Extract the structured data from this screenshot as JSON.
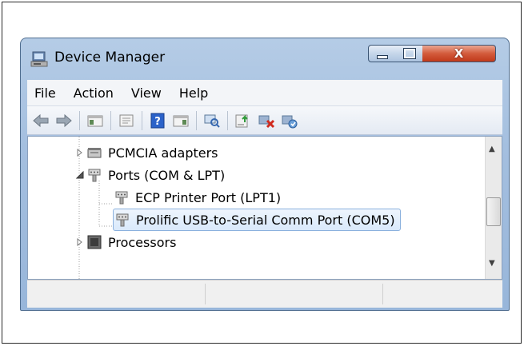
{
  "window": {
    "title": "Device Manager",
    "icon": "device-manager-icon",
    "controls": [
      "minimize-icon",
      "maximize-icon",
      "close-icon"
    ],
    "close_glyph": "X"
  },
  "menu": {
    "items": [
      "File",
      "Action",
      "View",
      "Help"
    ]
  },
  "toolbar": {
    "buttons": [
      "back-arrow-icon",
      "forward-arrow-icon",
      "show-hide-console-tree-icon",
      "properties-icon",
      "help-icon",
      "action-pane-icon",
      "scan-hardware-icon",
      "update-driver-icon",
      "uninstall-device-icon",
      "enable-device-icon"
    ]
  },
  "tree": {
    "rows": [
      {
        "label": "PCMCIA adapters",
        "icon": "pcmcia-adapter-icon",
        "expander": "collapsed"
      },
      {
        "label": "Ports (COM & LPT)",
        "icon": "port-icon",
        "expander": "expanded"
      },
      {
        "label": "ECP Printer Port (LPT1)",
        "icon": "port-icon"
      },
      {
        "label": "Prolific USB-to-Serial Comm Port (COM5)",
        "icon": "port-icon",
        "selected": true
      },
      {
        "label": "Processors",
        "icon": "processor-icon",
        "expander": "collapsed"
      }
    ]
  },
  "colors": {
    "titlebar": "#a9c3e1",
    "close_button": "#c8432a",
    "selection": "#dbeafb"
  }
}
